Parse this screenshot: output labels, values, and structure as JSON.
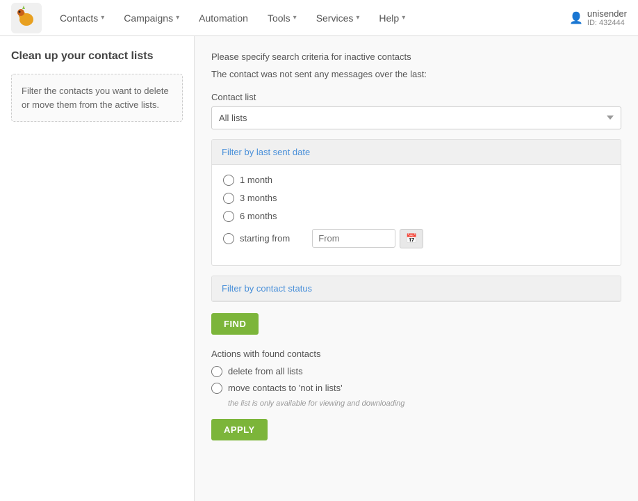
{
  "navbar": {
    "logo_alt": "Unisender logo",
    "items": [
      {
        "label": "Contacts",
        "has_dropdown": true
      },
      {
        "label": "Campaigns",
        "has_dropdown": true
      },
      {
        "label": "Automation",
        "has_dropdown": false
      },
      {
        "label": "Tools",
        "has_dropdown": true
      },
      {
        "label": "Services",
        "has_dropdown": true
      },
      {
        "label": "Help",
        "has_dropdown": true
      }
    ],
    "user_name": "unisender",
    "user_id": "ID: 432444"
  },
  "sidebar": {
    "title": "Clean up your contact lists",
    "description": "Filter the contacts you want to delete or move them from the active lists."
  },
  "main": {
    "description_line1": "Please specify search criteria for inactive contacts",
    "description_line2": "The contact was not sent any messages over the last:",
    "contact_list_label": "Contact list",
    "contact_list_value": "All lists",
    "filter_date_header": "Filter by last sent date",
    "radio_options": [
      {
        "id": "r1m",
        "label": "1 month",
        "checked": false
      },
      {
        "id": "r3m",
        "label": "3 months",
        "checked": false
      },
      {
        "id": "r6m",
        "label": "6 months",
        "checked": false
      },
      {
        "id": "rsf",
        "label": "starting from",
        "checked": false
      }
    ],
    "date_placeholder": "From",
    "filter_status_header": "Filter by contact status",
    "find_button": "FIND",
    "actions_title": "Actions with found contacts",
    "action_options": [
      {
        "id": "adel",
        "label": "delete from all lists"
      },
      {
        "id": "amov",
        "label": "move contacts to 'not in lists'"
      }
    ],
    "action_note": "the list is only available for viewing and downloading",
    "apply_button": "APPLY"
  }
}
